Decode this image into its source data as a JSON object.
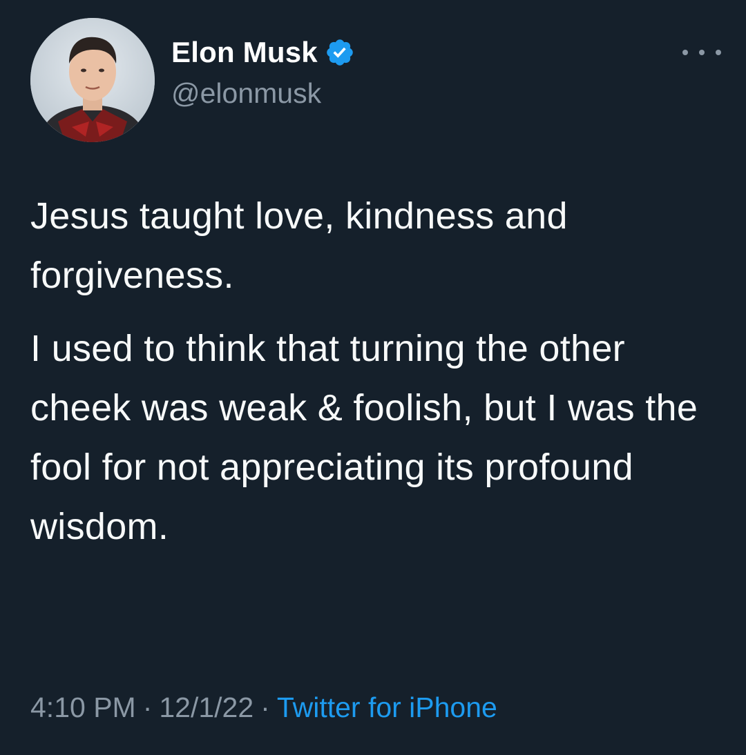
{
  "tweet": {
    "author": {
      "display_name": "Elon Musk",
      "handle": "@elonmusk",
      "verified_icon": "verified-badge-icon",
      "avatar_icon": "profile-avatar"
    },
    "more_icon": "more-horizontal-icon",
    "paragraphs": [
      "Jesus taught love, kindness and forgiveness.",
      "I used to think that turning the other cheek was weak & foolish, but I was the fool for not appreciating its profound wisdom."
    ],
    "time": "4:10 PM",
    "separator": "·",
    "date": "12/1/22",
    "source": "Twitter for iPhone"
  },
  "colors": {
    "background": "#15202b",
    "text": "#f7f9f9",
    "secondary_text": "#8b98a5",
    "accent": "#1d9bf0"
  }
}
